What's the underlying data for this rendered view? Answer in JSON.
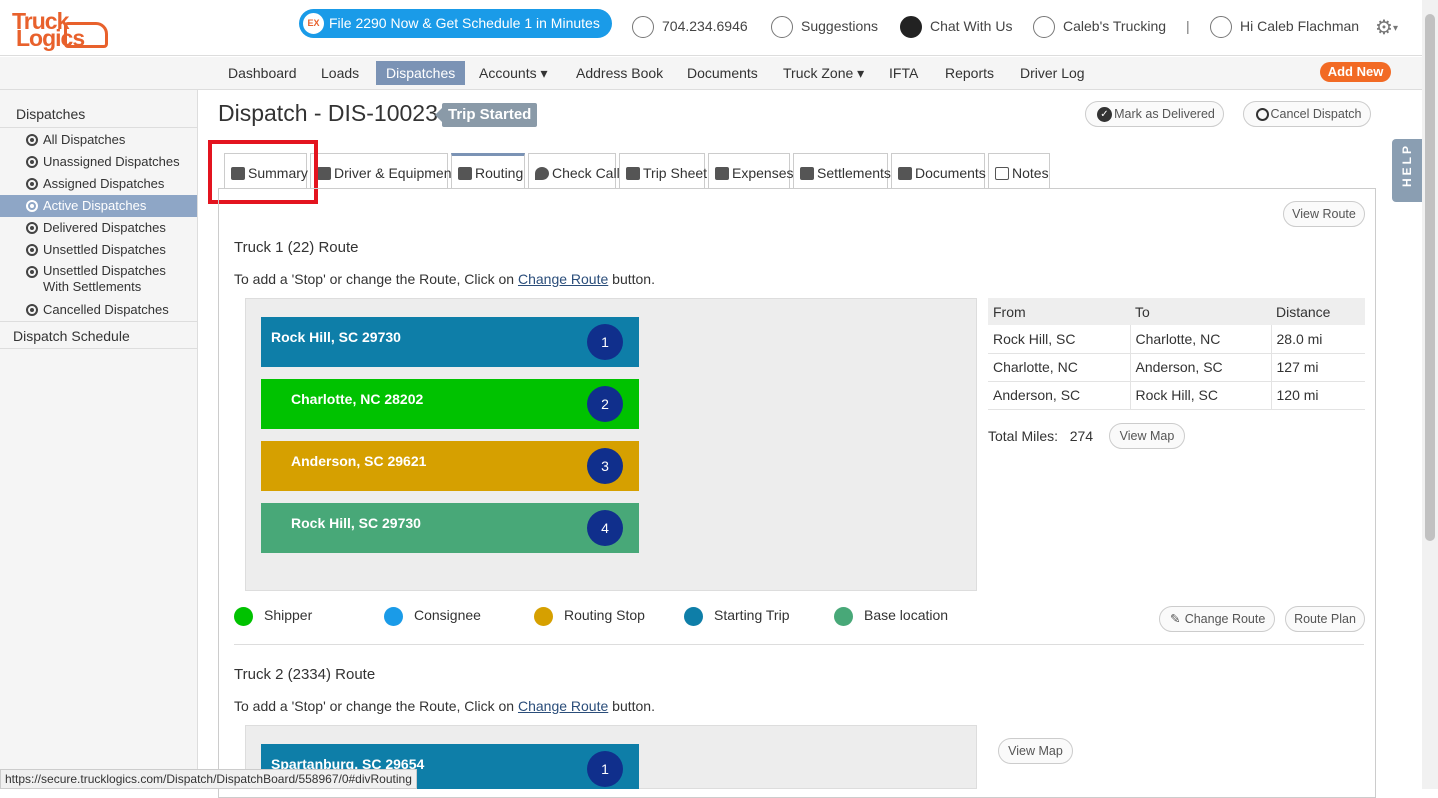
{
  "topbar": {
    "logo": [
      "Truck",
      "Logics"
    ],
    "promo_badge": "EX",
    "promo": "File 2290 Now & Get Schedule 1 in Minutes",
    "phone": "704.234.6946",
    "suggestions": "Suggestions",
    "chat": "Chat With Us",
    "company": "Caleb's Trucking",
    "separator": "|",
    "greeting": "Hi Caleb Flachman"
  },
  "menu": [
    {
      "label": "Dashboard"
    },
    {
      "label": "Loads"
    },
    {
      "label": "Dispatches",
      "active": true
    },
    {
      "label": "Accounts ▾"
    },
    {
      "label": "Address Book"
    },
    {
      "label": "Documents"
    },
    {
      "label": "Truck Zone ▾"
    },
    {
      "label": "IFTA"
    },
    {
      "label": "Reports"
    },
    {
      "label": "Driver Log"
    }
  ],
  "add_new": "Add New",
  "sidebar": {
    "heading": "Dispatches",
    "items": [
      "All Dispatches",
      "Unassigned Dispatches",
      "Assigned Dispatches",
      "Active Dispatches",
      "Delivered Dispatches",
      "Unsettled Dispatches",
      "Unsettled Dispatches With Settlements",
      "Cancelled Dispatches"
    ],
    "active_index": 3,
    "schedule": "Dispatch Schedule"
  },
  "page": {
    "title": "Dispatch - DIS-10023",
    "status": "Trip Started",
    "mark_delivered": "Mark as Delivered",
    "cancel": "Cancel Dispatch",
    "help": "HELP"
  },
  "tabs": [
    "Summary",
    "Driver & Equipment",
    "Routing",
    "Check Call",
    "Trip Sheet",
    "Expenses",
    "Settlements",
    "Documents",
    "Notes"
  ],
  "selected_tab": "Routing",
  "routing": {
    "view_route": "View Route",
    "truck1": {
      "title": "Truck 1 (22) Route",
      "note_pre": "To add a 'Stop' or change the Route, Click on ",
      "note_link": "Change Route",
      "note_post": " button.",
      "stops": [
        {
          "label": "Rock Hill, SC 29730",
          "num": "1",
          "color": "#0e7ea8"
        },
        {
          "label": "Charlotte, NC 28202",
          "num": "2",
          "color": "#00c200"
        },
        {
          "label": "Anderson, SC 29621",
          "num": "3",
          "color": "#d6a000"
        },
        {
          "label": "Rock Hill, SC 29730",
          "num": "4",
          "color": "#48a878"
        }
      ],
      "table_headers": [
        "From",
        "To",
        "Distance"
      ],
      "rows": [
        [
          "Rock Hill, SC",
          "Charlotte, NC",
          "28.0 mi"
        ],
        [
          "Charlotte, NC",
          "Anderson, SC",
          "127 mi"
        ],
        [
          "Anderson, SC",
          "Rock Hill, SC",
          "120 mi"
        ]
      ],
      "total_label": "Total Miles:",
      "total_value": "274",
      "view_map": "View Map"
    },
    "legend": [
      {
        "label": "Shipper",
        "color": "#00c200"
      },
      {
        "label": "Consignee",
        "color": "#1a9be8"
      },
      {
        "label": "Routing Stop",
        "color": "#d6a000"
      },
      {
        "label": "Starting Trip",
        "color": "#0e7ea8"
      },
      {
        "label": "Base location",
        "color": "#48a878"
      }
    ],
    "change_route": "Change Route",
    "route_plan": "Route Plan",
    "truck2": {
      "title": "Truck 2 (2334) Route",
      "note_pre": "To add a 'Stop' or change the Route, Click on ",
      "note_link": "Change Route",
      "note_post": " button.",
      "stop1": {
        "label": "Spartanburg, SC 29654",
        "num": "1",
        "color": "#0e7ea8"
      },
      "view_map": "View Map"
    }
  },
  "status_url": "https://secure.trucklogics.com/Dispatch/DispatchBoard/558967/0#divRouting"
}
